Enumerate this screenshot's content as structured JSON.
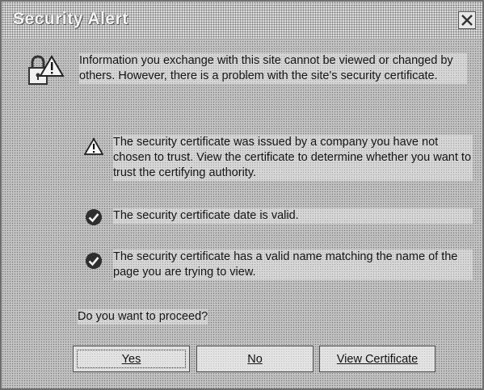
{
  "window": {
    "title": "Security Alert"
  },
  "intro": "Information you exchange with this site cannot be viewed or changed by others. However, there is a problem with the site's security certificate.",
  "items": [
    {
      "icon": "warning-icon",
      "text": "The security certificate was issued by a company you have not chosen to trust. View the certificate to determine whether you want to trust the certifying authority."
    },
    {
      "icon": "check-icon",
      "text": "The security certificate date is valid."
    },
    {
      "icon": "check-icon",
      "text": "The security certificate has a valid name matching the name of the page you are trying to view."
    }
  ],
  "question": "Do you want to proceed?",
  "buttons": {
    "yes": "Yes",
    "no": "No",
    "view_certificate": "View Certificate"
  }
}
